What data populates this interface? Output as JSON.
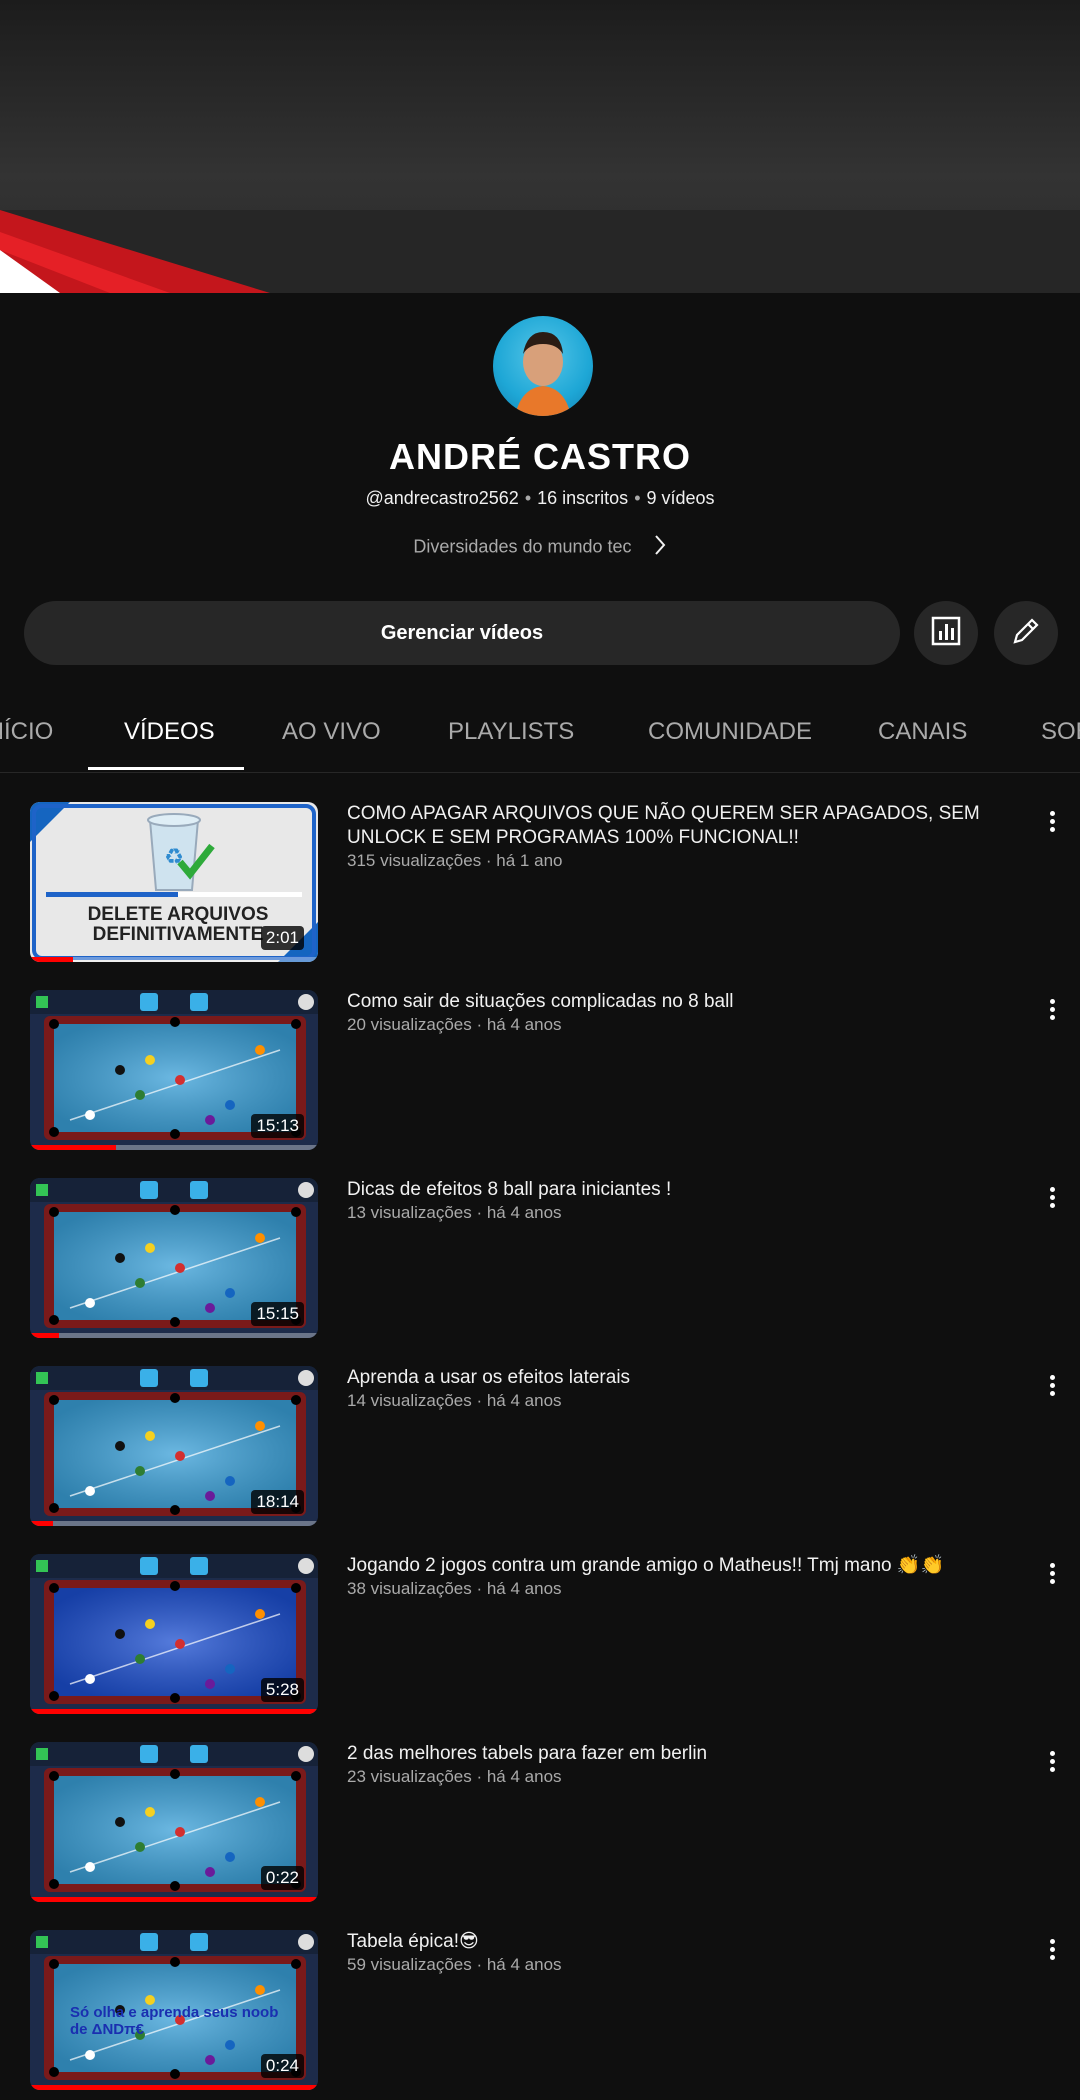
{
  "channel": {
    "name": "ANDRÉ CASTRO",
    "handle": "@andrecastro2562",
    "subscribers": "16 inscritos",
    "video_count": "9 vídeos",
    "description": "Diversidades do mundo tec"
  },
  "actions": {
    "manage_label": "Gerenciar vídeos",
    "analytics_icon": "analytics-icon",
    "edit_icon": "pencil-icon"
  },
  "tabs": [
    {
      "label": "INÍCIO"
    },
    {
      "label": "VÍDEOS",
      "active": true
    },
    {
      "label": "AO VIVO"
    },
    {
      "label": "PLAYLISTS"
    },
    {
      "label": "COMUNIDADE"
    },
    {
      "label": "CANAIS"
    },
    {
      "label": "SOBRE"
    }
  ],
  "videos": [
    {
      "title": "COMO APAGAR ARQUIVOS QUE NÃO QUEREM SER APAGADOS,  SEM UNLOCK E SEM PROGRAMAS 100% FUNCIONAL!!",
      "meta": "315 visualizações · há 1 ano",
      "duration": "2:01",
      "watched": 0.15,
      "thumb_text": "DELETE ARQUIVOS DEFINITIVAMENTE"
    },
    {
      "title": "Como sair de situações complicadas no 8 ball",
      "meta": "20 visualizações · há 4 anos",
      "duration": "15:13",
      "watched": 0.3
    },
    {
      "title": "Dicas de efeitos 8 ball para iniciantes !",
      "meta": "13 visualizações · há 4 anos",
      "duration": "15:15",
      "watched": 0.1
    },
    {
      "title": "Aprenda a usar os efeitos laterais",
      "meta": "14 visualizações · há 4 anos",
      "duration": "18:14",
      "watched": 0.08
    },
    {
      "title": "Jogando 2 jogos contra um grande amigo o Matheus!! Tmj mano 👏👏",
      "meta": "38 visualizações · há 4 anos",
      "duration": "5:28",
      "watched": 1.0
    },
    {
      "title": "2 das melhores tabels para fazer em berlin",
      "meta": "23 visualizações · há 4 anos",
      "duration": "0:22",
      "watched": 1.0
    },
    {
      "title": "Tabela épica!😎",
      "meta": "59 visualizações · há 4 anos",
      "duration": "0:24",
      "watched": 1.0,
      "thumb_text": "Só olha e aprenda seus noob de ΔNDπ€"
    }
  ]
}
